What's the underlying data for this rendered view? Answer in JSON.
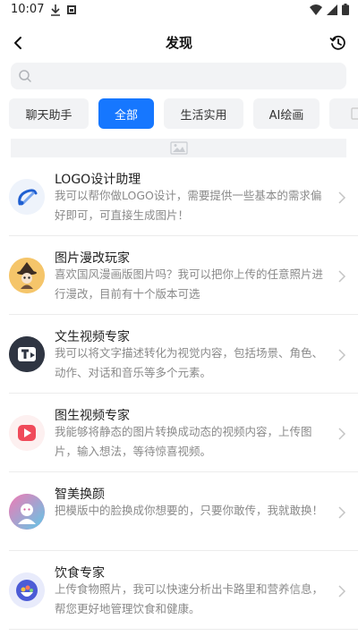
{
  "status_bar": {
    "time": "10:07"
  },
  "header": {
    "title": "发现"
  },
  "search": {
    "placeholder": ""
  },
  "tabs": [
    {
      "label": "聊天助手",
      "active": false
    },
    {
      "label": "全部",
      "active": true
    },
    {
      "label": "生活实用",
      "active": false
    },
    {
      "label": "AI绘画",
      "active": false
    }
  ],
  "colors": {
    "accent": "#1677ff",
    "muted_bg": "#f2f3f5"
  },
  "items": [
    {
      "title": "LOGO设计助理",
      "desc": "我可以帮你做LOGO设计，需要提供一些基本的需求偏好即可，可直接生成图片！",
      "icon": "logo-design-icon"
    },
    {
      "title": "图片漫改玩家",
      "desc": "喜欢国风漫画版图片吗？我可以把你上传的任意照片进行漫改，目前有十个版本可选",
      "icon": "comic-wizard-icon"
    },
    {
      "title": "文生视频专家",
      "desc": "我可以将文字描述转化为视觉内容，包括场景、角色、动作、对话和音乐等多个元素。",
      "icon": "text-to-video-icon"
    },
    {
      "title": "图生视频专家",
      "desc": "我能够将静态的图片转换成动态的视频内容，上传图片，输入想法，等待惊喜视频。",
      "icon": "image-to-video-icon"
    },
    {
      "title": "智美换颜",
      "desc": "把模版中的脸换成你想要的，只要你敢传，我就敢换！",
      "icon": "face-swap-icon"
    },
    {
      "title": "饮食专家",
      "desc": "上传食物照片，我可以快速分析出卡路里和营养信息，帮您更好地管理饮食和健康。",
      "icon": "food-expert-icon"
    }
  ]
}
